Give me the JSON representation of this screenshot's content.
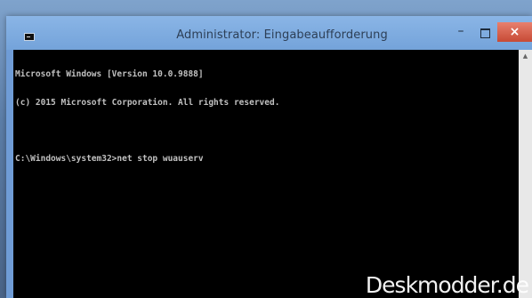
{
  "window": {
    "title": "Administrator: Eingabeaufforderung",
    "controls": {
      "minimize": "–",
      "close": "×"
    }
  },
  "console": {
    "lines": [
      "Microsoft Windows [Version 10.0.9888]",
      "(c) 2015 Microsoft Corporation. All rights reserved.",
      "",
      "C:\\Windows\\system32>net stop wuauserv"
    ]
  },
  "scrollbar": {
    "up_arrow": "▲"
  },
  "watermark": "Deskmodder.de",
  "colors": {
    "titlebar": "#74a3da",
    "console_bg": "#000000",
    "console_text": "#c0c0c0",
    "close_button": "#c74a35"
  }
}
